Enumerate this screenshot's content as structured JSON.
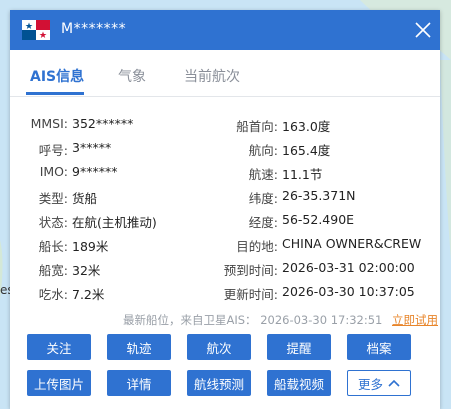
{
  "map": {
    "edge_text": "es!"
  },
  "header": {
    "ship_name": "M*******"
  },
  "tabs": [
    {
      "label": "AIS信息",
      "active": true
    },
    {
      "label": "气象",
      "active": false
    },
    {
      "label": "当前航次",
      "active": false
    }
  ],
  "ais_left": [
    {
      "label": "MMSI:",
      "value": "352******"
    },
    {
      "label": "呼号:",
      "value": "3*****"
    },
    {
      "label": "IMO:",
      "value": "9******"
    },
    {
      "label": "类型:",
      "value": "货船"
    },
    {
      "label": "状态:",
      "value": "在航(主机推动)"
    },
    {
      "label": "船长:",
      "value": "189米"
    },
    {
      "label": "船宽:",
      "value": "32米"
    },
    {
      "label": "吃水:",
      "value": "7.2米"
    }
  ],
  "ais_right": [
    {
      "label": "船首向:",
      "value": "163.0度"
    },
    {
      "label": "航向:",
      "value": "165.4度"
    },
    {
      "label": "航速:",
      "value": "11.1节"
    },
    {
      "label": "纬度:",
      "value": "26-35.371N"
    },
    {
      "label": "经度:",
      "value": "56-52.490E"
    },
    {
      "label": "目的地:",
      "value": "CHINA OWNER&CREW"
    },
    {
      "label": "预到时间:",
      "value": "2026-03-31 02:00:00"
    },
    {
      "label": "更新时间:",
      "value": "2026-03-30 10:37:05"
    }
  ],
  "update": {
    "text": "最新船位，来自卫星AIS：",
    "time": "2026-03-30 17:32:51",
    "try_label": "立即试用"
  },
  "buttons_row1": [
    "关注",
    "轨迹",
    "航次",
    "提醒",
    "档案"
  ],
  "buttons_row2": [
    "上传图片",
    "详情",
    "航线预测",
    "船载视频"
  ],
  "more_button": {
    "label": "更多"
  },
  "colors": {
    "primary": "#2f72d1",
    "accent": "#e8852a"
  }
}
